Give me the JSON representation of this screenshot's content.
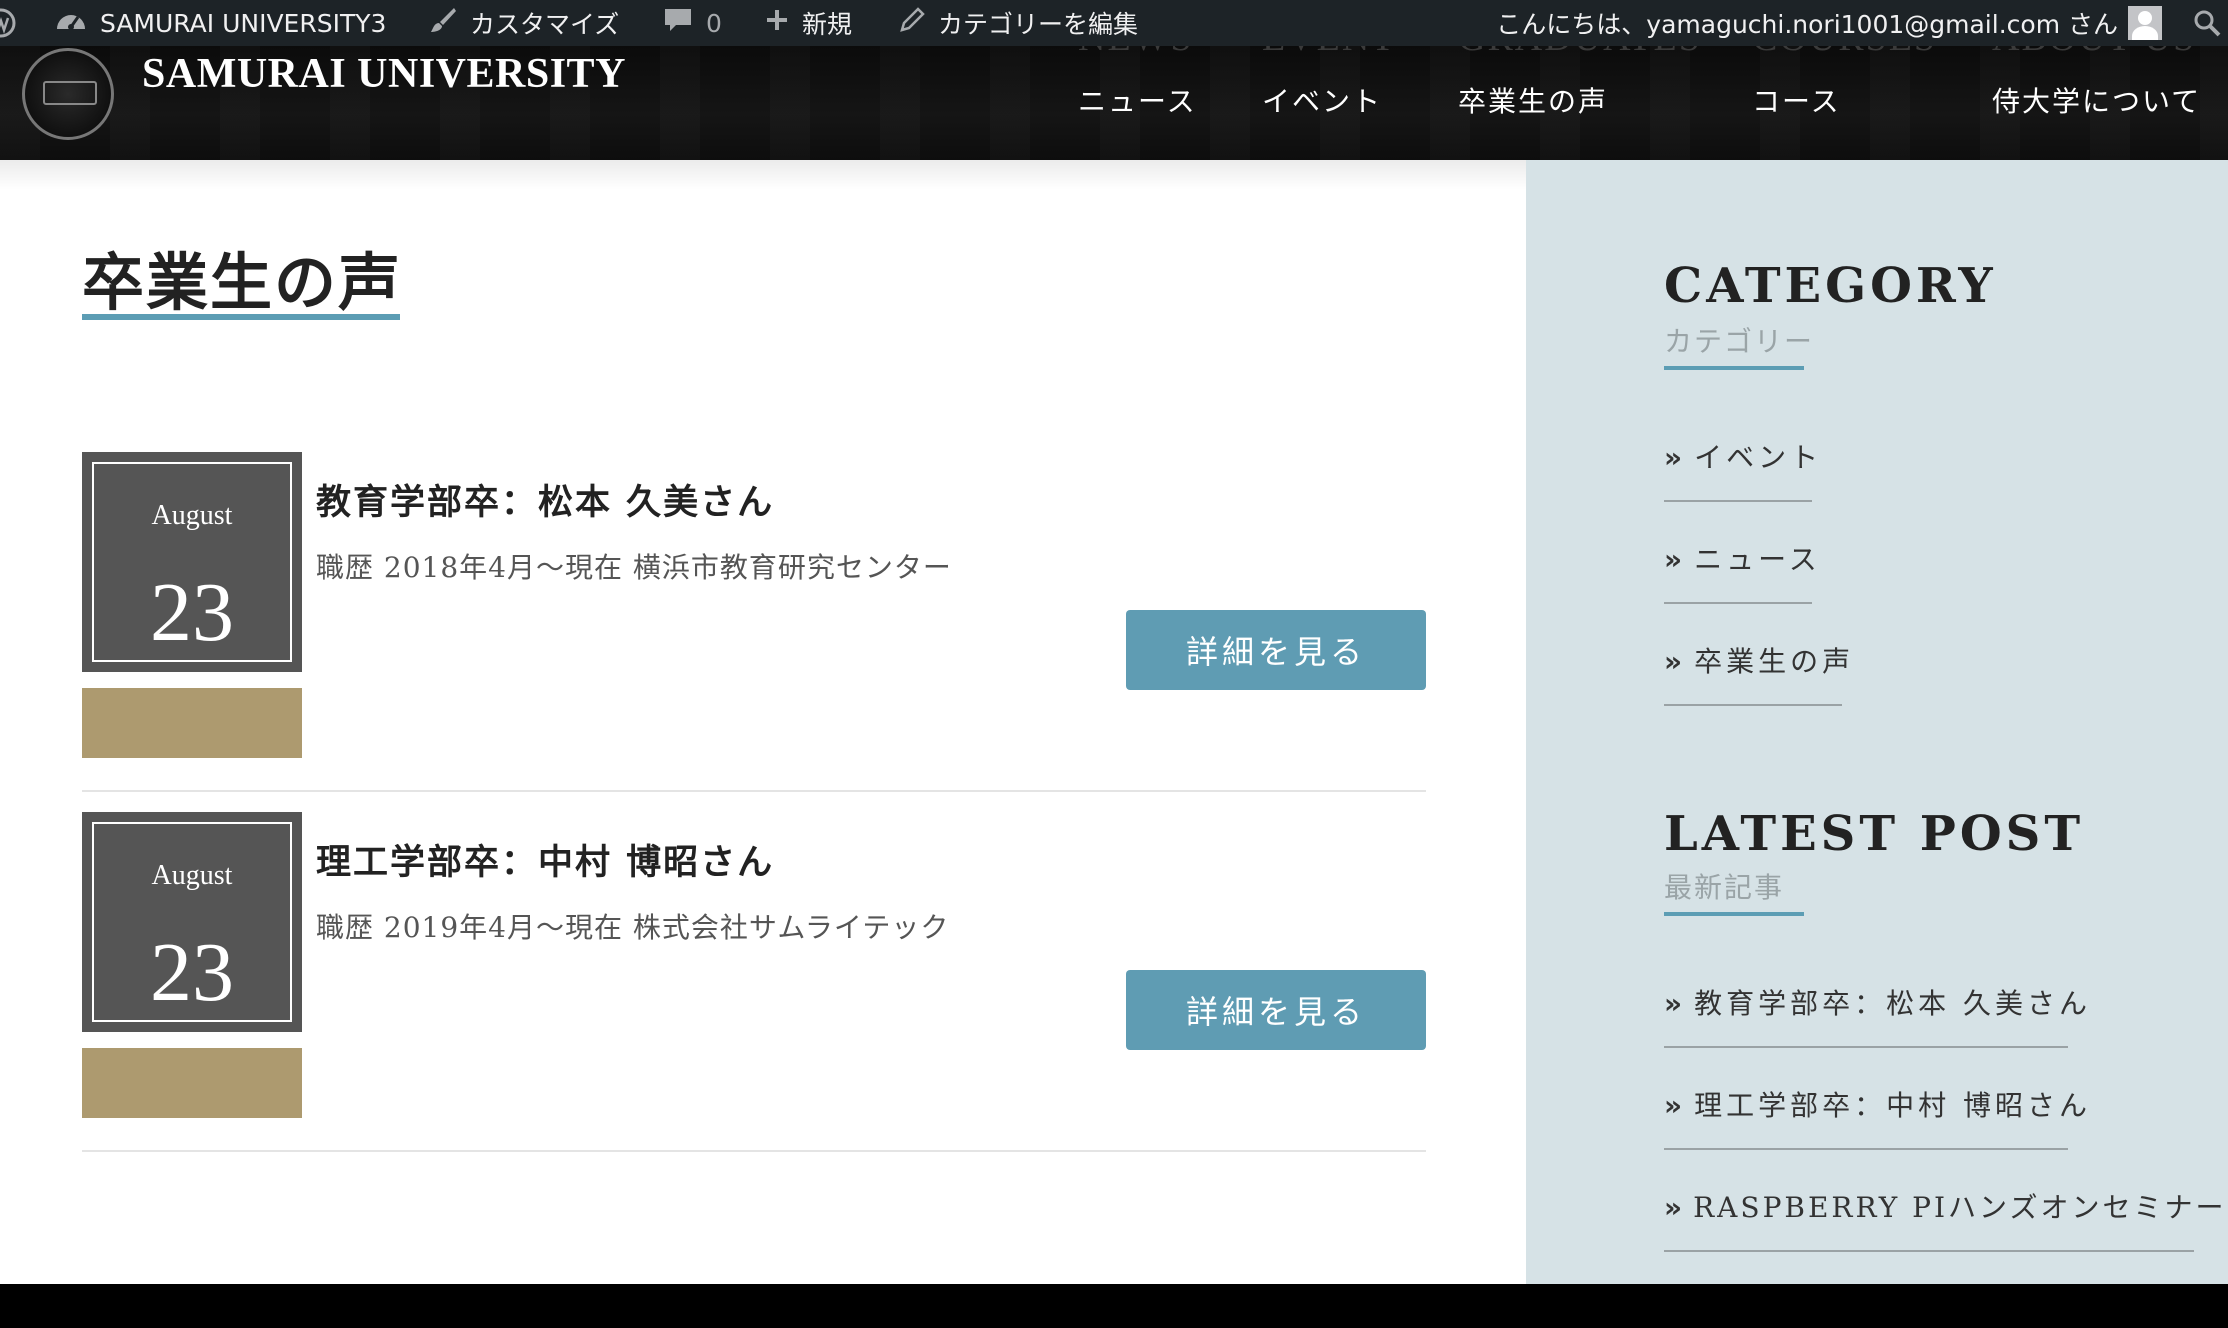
{
  "adminbar": {
    "site_name": "SAMURAI UNIVERSITY3",
    "customize": "カスタマイズ",
    "comments_count": "0",
    "new": "新規",
    "edit_category": "カテゴリーを編集",
    "greeting": "こんにちは、yamaguchi.nori1001@gmail.com さん"
  },
  "header": {
    "site_title": "SAMURAI UNIVERSITY",
    "nav": [
      {
        "en": "NEWS",
        "jp": "ニュース"
      },
      {
        "en": "EVENT",
        "jp": "イベント"
      },
      {
        "en": "GRADUATES",
        "jp": "卒業生の声"
      },
      {
        "en": "COURSES",
        "jp": "コース"
      },
      {
        "en": "ABOUT US",
        "jp": "侍大学について"
      }
    ]
  },
  "main": {
    "page_title": "卒業生の声",
    "posts": [
      {
        "month": "August",
        "day": "23",
        "title": "教育学部卒：松本 久美さん",
        "excerpt": "職歴 2018年4月〜現在 横浜市教育研究センター",
        "more_label": "詳細を見る"
      },
      {
        "month": "August",
        "day": "23",
        "title": "理工学部卒：中村 博昭さん",
        "excerpt": "職歴 2019年4月〜現在 株式会社サムライテック",
        "more_label": "詳細を見る"
      }
    ]
  },
  "sidebar": {
    "category": {
      "title": "CATEGORY",
      "subtitle": "カテゴリー",
      "items": [
        "イベント",
        "ニュース",
        "卒業生の声"
      ]
    },
    "latest": {
      "title": "LATEST POST",
      "subtitle": "最新記事",
      "items": [
        "教育学部卒：松本 久美さん",
        "理工学部卒：中村 博昭さん",
        "RASPBERRY PIハンズオンセミナー"
      ]
    }
  },
  "colors": {
    "accent_blue": "#5f9cb3",
    "category_band": "#ad9a6f",
    "sidebar_bg": "#d6e2e6"
  }
}
